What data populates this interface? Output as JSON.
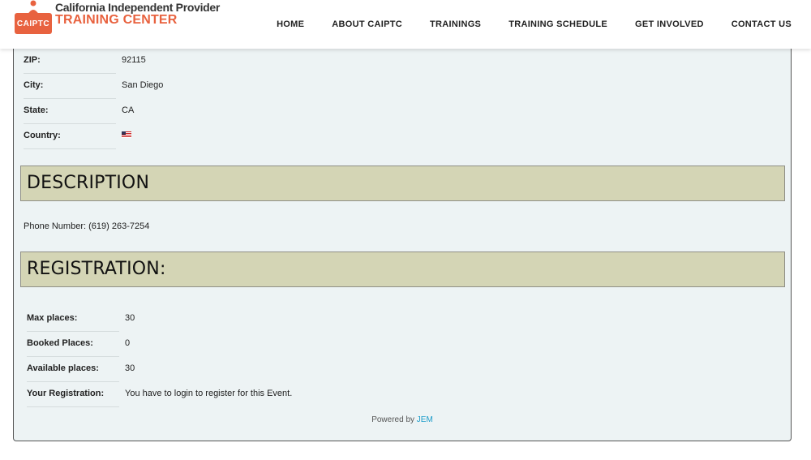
{
  "header": {
    "logo_badge": "CAIPTC",
    "logo_line1": "California Independent Provider",
    "logo_line2": "TRAINING CENTER",
    "nav": [
      "HOME",
      "ABOUT CAIPTC",
      "TRAININGS",
      "TRAINING SCHEDULE",
      "GET INVOLVED",
      "CONTACT US"
    ]
  },
  "location": {
    "zip_label": "ZIP:",
    "zip": "92115",
    "city_label": "City:",
    "city": "San Diego",
    "state_label": "State:",
    "state": "CA",
    "country_label": "Country:"
  },
  "description": {
    "heading": "DESCRIPTION",
    "text": "Phone Number: (619) 263-7254"
  },
  "registration": {
    "heading": "REGISTRATION:",
    "max_label": "Max places:",
    "max": "30",
    "booked_label": "Booked Places:",
    "booked": "0",
    "available_label": "Available places:",
    "available": "30",
    "your_label": "Your Registration:",
    "your": "You have to login to register for this Event."
  },
  "footer": {
    "powered_by": "Powered by",
    "link": "JEM"
  },
  "colors": {
    "brand": "#e8623f",
    "section_bg": "#d4d5b5",
    "panel_bg": "#edf3f4",
    "link": "#1a9bc9"
  }
}
